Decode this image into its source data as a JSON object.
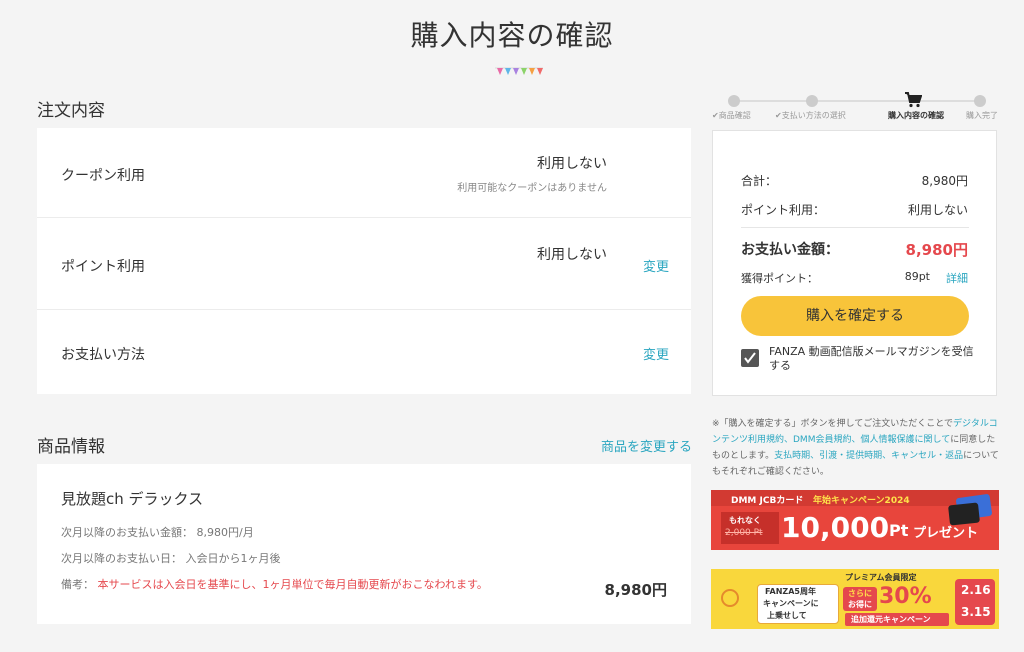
{
  "page": {
    "title": "購入内容の確認"
  },
  "order": {
    "heading": "注文内容",
    "coupon": {
      "label": "クーポン利用",
      "value": "利用しない",
      "note": "利用可能なクーポンはありません"
    },
    "points": {
      "label": "ポイント利用",
      "value": "利用しない",
      "change": "変更"
    },
    "payment": {
      "label": "お支払い方法",
      "change": "変更"
    }
  },
  "product": {
    "heading": "商品情報",
    "change_link": "商品を変更する",
    "name": "見放題ch デラックス",
    "next_amount": "次月以降のお支払い金額： 8,980円/月",
    "next_date": "次月以降のお支払い日： 入会日から1ヶ月後",
    "note_label": "備考：",
    "note_text": "本サービスは入会日を基準にし、1ヶ月単位で毎月自動更新がおこなわれます。",
    "price": "8,980円"
  },
  "steps": [
    {
      "label": "✔商品確認"
    },
    {
      "label": "✔支払い方法の選択"
    },
    {
      "label": "購入内容の確認"
    },
    {
      "label": "購入完了"
    }
  ],
  "summary": {
    "total_label": "合計：",
    "total_value": "8,980円",
    "points_label": "ポイント利用：",
    "points_value": "利用しない",
    "pay_label": "お支払い金額：",
    "pay_value": "8,980円",
    "earn_label": "獲得ポイント：",
    "earn_value": "89pt",
    "earn_detail": "詳細",
    "confirm_button": "購入を確定する",
    "mail_label": "FANZA 動画配信版メールマガジンを受信する"
  },
  "notice": {
    "prefix": "※「購入を確定する」ボタンを押してご注文いただくことで",
    "link1": "デジタルコンテンツ利用規約、DMM会員規約、個人情報保護に関して",
    "mid": "に同意したものとします。",
    "link2": "支払時期、引渡・提供時期、キャンセル・返品",
    "suffix": "についてもそれぞれご確認ください。"
  },
  "banner1": {
    "brand": "DMM JCBカード",
    "campaign": "年始キャンペーン2024",
    "tag_top": "もれなく",
    "tag_bottom": "2,000 Pt",
    "amount": "10,000",
    "unit": "Pt",
    "present": "プレゼント"
  },
  "banner2": {
    "limited": "プレミアム会員限定",
    "line1": "FANZA5周年",
    "line2": "キャンペーンに",
    "line3": "上乗せして",
    "badge1": "さらに",
    "badge2": "お得に",
    "percent": "30%",
    "rebate": "追加還元キャンペーン",
    "date1": "2.16",
    "date2": "3.15"
  },
  "colors": {
    "accent": "#2aa6c0",
    "button": "#f8c43a",
    "price_red": "#e5484d",
    "banner1_bg": "#e8453c",
    "banner2_bg": "#f9d73c"
  }
}
